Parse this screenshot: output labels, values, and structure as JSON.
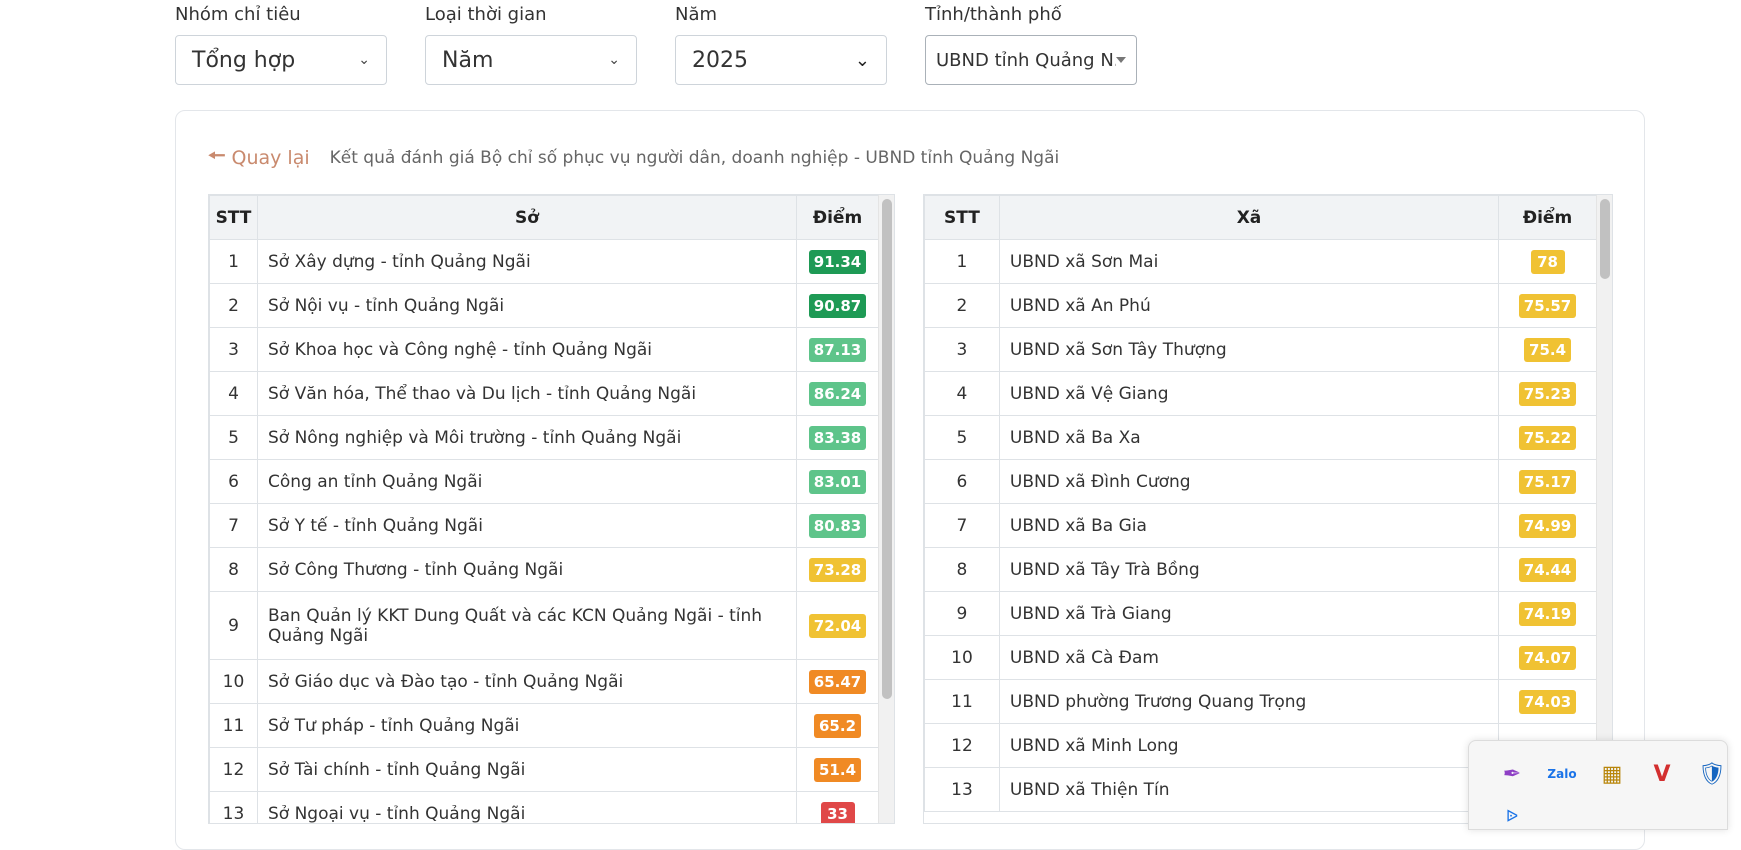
{
  "filters": [
    {
      "label": "Nhóm chỉ tiêu",
      "value": "Tổng hợp"
    },
    {
      "label": "Loại thời gian",
      "value": "Năm"
    },
    {
      "label": "Năm",
      "value": "2025"
    },
    {
      "label": "Tỉnh/thành phố",
      "value": "UBND tỉnh Quảng N..."
    }
  ],
  "back_label": "Quay lại",
  "title": "Kết quả đánh giá Bộ chỉ số phục vụ người dân, doanh nghiệp - UBND tỉnh Quảng Ngãi",
  "left_table": {
    "headers": [
      "STT",
      "Sở",
      "Điểm"
    ],
    "rows": [
      {
        "stt": "1",
        "name": "Sở Xây dựng - tỉnh Quảng Ngãi",
        "score": "91.34"
      },
      {
        "stt": "2",
        "name": "Sở Nội vụ - tỉnh Quảng Ngãi",
        "score": "90.87"
      },
      {
        "stt": "3",
        "name": "Sở Khoa học và Công nghệ - tỉnh Quảng Ngãi",
        "score": "87.13"
      },
      {
        "stt": "4",
        "name": "Sở Văn hóa, Thể thao và Du lịch - tỉnh Quảng Ngãi",
        "score": "86.24"
      },
      {
        "stt": "5",
        "name": "Sở Nông nghiệp và Môi trường - tỉnh Quảng Ngãi",
        "score": "83.38"
      },
      {
        "stt": "6",
        "name": "Công an tỉnh Quảng Ngãi",
        "score": "83.01"
      },
      {
        "stt": "7",
        "name": "Sở Y tế - tỉnh Quảng Ngãi",
        "score": "80.83"
      },
      {
        "stt": "8",
        "name": "Sở Công Thương - tỉnh Quảng Ngãi",
        "score": "73.28"
      },
      {
        "stt": "9",
        "name": "Ban Quản lý KKT Dung Quất và các KCN Quảng Ngãi - tỉnh Quảng Ngãi",
        "score": "72.04"
      },
      {
        "stt": "10",
        "name": "Sở Giáo dục và Đào tạo - tỉnh Quảng Ngãi",
        "score": "65.47"
      },
      {
        "stt": "11",
        "name": "Sở Tư pháp - tỉnh Quảng Ngãi",
        "score": "65.2"
      },
      {
        "stt": "12",
        "name": "Sở Tài chính - tỉnh Quảng Ngãi",
        "score": "51.4"
      },
      {
        "stt": "13",
        "name": "Sở Ngoại vụ - tỉnh Quảng Ngãi",
        "score": "33"
      }
    ]
  },
  "right_table": {
    "headers": [
      "STT",
      "Xã",
      "Điểm"
    ],
    "rows": [
      {
        "stt": "1",
        "name": "UBND xã Sơn Mai",
        "score": "78"
      },
      {
        "stt": "2",
        "name": "UBND xã An Phú",
        "score": "75.57"
      },
      {
        "stt": "3",
        "name": "UBND xã Sơn Tây Thượng",
        "score": "75.4"
      },
      {
        "stt": "4",
        "name": "UBND xã Vệ Giang",
        "score": "75.23"
      },
      {
        "stt": "5",
        "name": "UBND xã Ba Xa",
        "score": "75.22"
      },
      {
        "stt": "6",
        "name": "UBND xã Đình Cương",
        "score": "75.17"
      },
      {
        "stt": "7",
        "name": "UBND xã Ba Gia",
        "score": "74.99"
      },
      {
        "stt": "8",
        "name": "UBND xã Tây Trà Bồng",
        "score": "74.44"
      },
      {
        "stt": "9",
        "name": "UBND xã Trà Giang",
        "score": "74.19"
      },
      {
        "stt": "10",
        "name": "UBND xã Cà Đam",
        "score": "74.07"
      },
      {
        "stt": "11",
        "name": "UBND phường Trương Quang Trọng",
        "score": "74.03"
      },
      {
        "stt": "12",
        "name": "UBND xã Minh Long",
        "score": ""
      },
      {
        "stt": "13",
        "name": "UBND xã Thiện Tín",
        "score": ""
      }
    ]
  },
  "colors": {
    "dark_green": "#1e9a55",
    "light_green": "#5ec48a",
    "yellow": "#f0c233",
    "orange": "#f08a24",
    "red": "#e04848",
    "back_link": "#c98a6e"
  },
  "tray_icons": [
    "feather-icon",
    "zalo-icon",
    "grid-app-icon",
    "v-antivirus-icon",
    "shield-icon",
    "bluetooth-icon"
  ]
}
